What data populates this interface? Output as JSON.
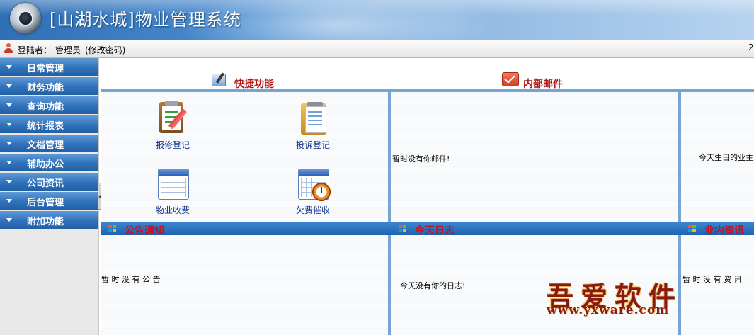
{
  "app": {
    "title": "[山湖水城]物业管理系统"
  },
  "userbar": {
    "login_label": "登陆者：",
    "user": "管理员",
    "change_password": "(修改密码)",
    "right_text": "2"
  },
  "sidebar": {
    "items": [
      {
        "label": "日常管理"
      },
      {
        "label": "财务功能"
      },
      {
        "label": "查询功能"
      },
      {
        "label": "统计报表"
      },
      {
        "label": "文档管理"
      },
      {
        "label": "辅助办公"
      },
      {
        "label": "公司资讯"
      },
      {
        "label": "后台管理"
      },
      {
        "label": "附加功能"
      }
    ]
  },
  "main": {
    "quick_functions_title": "快捷功能",
    "internal_mail_title": "内部邮件",
    "shortcuts": {
      "repair": "报修登记",
      "complaint": "投诉登记",
      "fee": "物业收费",
      "arrears": "欠费催收"
    },
    "no_mail_msg": "暂时没有你邮件!",
    "birthday_msg": "今天生日的业主",
    "bars": {
      "notice": "公告通知",
      "diary": "今天日志",
      "industry": "业内资讯"
    },
    "no_notice_msg": "暂 时 没 有 公 告",
    "no_diary_msg": "今天没有你的日志!",
    "no_news_msg": "暂 时 没 有 资 讯"
  },
  "watermark": {
    "line1": "吾爱软件",
    "line2": "www.yxware.com"
  },
  "colors": {
    "sidebar_button": "#2f72bc",
    "title_bar": "#1f63b0",
    "title_red": "#b01818",
    "shortcut_label": "#102f8a"
  },
  "icons": {
    "repair": "clipboard-pencil-icon",
    "complaint": "notepad-icon",
    "fee": "calendar-icon",
    "arrears": "calendar-clock-icon"
  }
}
